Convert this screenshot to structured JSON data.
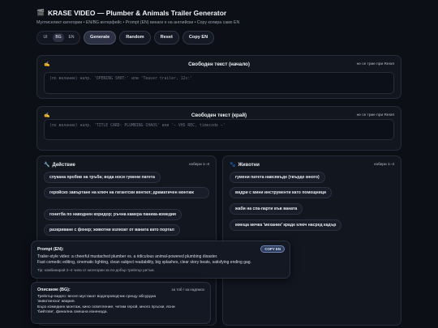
{
  "header": {
    "title": "KRASE VIDEO — Plumber & Animals Trailer Generator",
    "icon": "clapperboard-icon",
    "subtitle": "Мултиселект категории • EN/BG интерфейс • Prompt (EN) винаги е на английски • Copy копира само EN"
  },
  "lang": {
    "ui": "UI",
    "bg": "BG",
    "en": "EN",
    "selected": "BG"
  },
  "toolbar": {
    "generate": "Generate",
    "random": "Random",
    "reset": "Reset",
    "copy_en": "Copy EN"
  },
  "free_start": {
    "icon": "pencil-icon",
    "title": "Свободен текст (начало)",
    "hint": "не се трие при Reset",
    "placeholder": "(по желание) напр. 'OPENING SHOT:' или 'Teaser trailer, 12s:'"
  },
  "free_end": {
    "icon": "pencil-icon",
    "title": "Свободен текст (край)",
    "hint": "не се трие при Reset",
    "placeholder": "(по желание) напр. 'TITLE CARD: PLUMBING CHAOS' или '— VHS REC, timecode —'"
  },
  "action": {
    "icon": "wrench-icon",
    "title": "Действие",
    "hint": "избери 1–3",
    "items": [
      "спукана пробив на тръба; вода носи гумени патета",
      "геройско завъртане на ключ на гигантски вентил; драматичен монтаж",
      "гонитба по наводнен коридор; ръчна камера паника-комедия",
      "разкриване с фенер; животни излизат от ваната като портал"
    ]
  },
  "animals": {
    "icon": "paw-icon",
    "title": "Животни",
    "hint": "избери 1–4",
    "items": [
      "гумени патета навсякъде (твърде много)",
      "видри с мини инструменти като помощници",
      "жаби на спа-парти във ваната",
      "миеща мечка 'механик' краде ключ насред кадър"
    ]
  },
  "prompt": {
    "label": "Prompt (EN):",
    "copy": "COPY EN",
    "line1": "Trailer-style video: a cheerful mustached plumber vs. a ridiculous animal-powered plumbing disaster.",
    "line2": "Fast comedic editing, cinematic lighting, clean subject readability, big splashes, clear story beats, satisfying ending gag.",
    "tip": "Tip: комбинирай 2–4 чипа от категории за по-добър трейлър ритъм."
  },
  "description": {
    "label": "Описание (BG):",
    "hint": "за тоб / за надписи",
    "line1": "Трейлър-видео: весел мустакат водопроводчик срещу абсурдна",
    "line2": "'животинска' авария.",
    "line3": "Бърз комедиен монтаж, кино осветление, четим герой, много пръски, ясни",
    "line4": "'бийтове', финална смешна изненада."
  }
}
